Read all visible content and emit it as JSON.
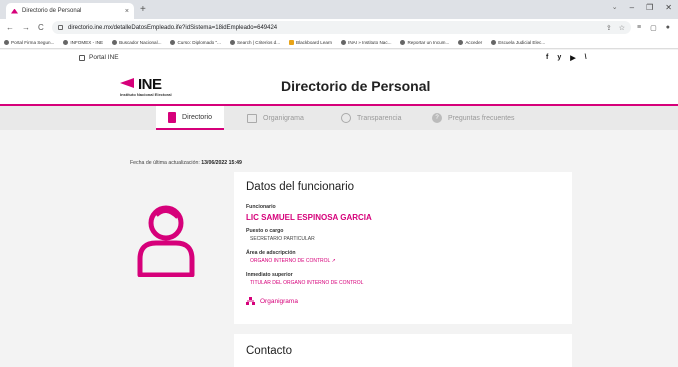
{
  "browser": {
    "tab_title": "Directorio de Personal",
    "tab_close": "×",
    "new_tab": "+",
    "url": "directorio.ine.mx/detalleDatosEmpleado.ife?idSistema=18idEmpleado=649424",
    "nav": {
      "back": "←",
      "forward": "→",
      "reload": "C"
    },
    "window": {
      "dropdown": "⌄",
      "minimize": "–",
      "maximize": "❐",
      "close": "✕"
    },
    "bookmarks": [
      "Portal Firma Segun...",
      "INFOMEX - INE",
      "Buscador Nacional...",
      "Curso: Diplomado \"...",
      "Search | Criterios d...",
      "Blackboard Learn",
      "INAI » Instituto Nac...",
      "Reportar un Incum...",
      "Acceder",
      "Escuela Judicial Elec..."
    ]
  },
  "site": {
    "portal_link": "Portal INE",
    "social": [
      "f",
      "y",
      "▶",
      "\\"
    ],
    "logo_text": "INE",
    "logo_sub": "Instituto Nacional Electoral",
    "page_title": "Directorio de Personal",
    "tabs": [
      {
        "label": "Directorio",
        "icon": "directory-icon"
      },
      {
        "label": "Organigrama",
        "icon": "org-chart-icon"
      },
      {
        "label": "Transparencia",
        "icon": "transparency-icon"
      },
      {
        "label": "Preguntas frecuentes",
        "icon": "faq-icon"
      }
    ],
    "accent": "#d6007a"
  },
  "content": {
    "updated_label": "Fecha de última actualización:",
    "updated_value": "13/06/2022 15:49",
    "card_title": "Datos del funcionario",
    "fields": {
      "funcionario_label": "Funcionario",
      "funcionario_value": "LIC SAMUEL ESPINOSA GARCIA",
      "puesto_label": "Puesto o cargo",
      "puesto_value": "SECRETARIO PARTICULAR",
      "area_label": "Área de adscripción",
      "area_value": "ORGANO INTERNO DE CONTROL",
      "superior_label": "Inmediato superior",
      "superior_value": "TITULAR DEL ORGANO INTERNO DE CONTROL"
    },
    "org_link": "Organigrama",
    "contact_title": "Contacto"
  }
}
